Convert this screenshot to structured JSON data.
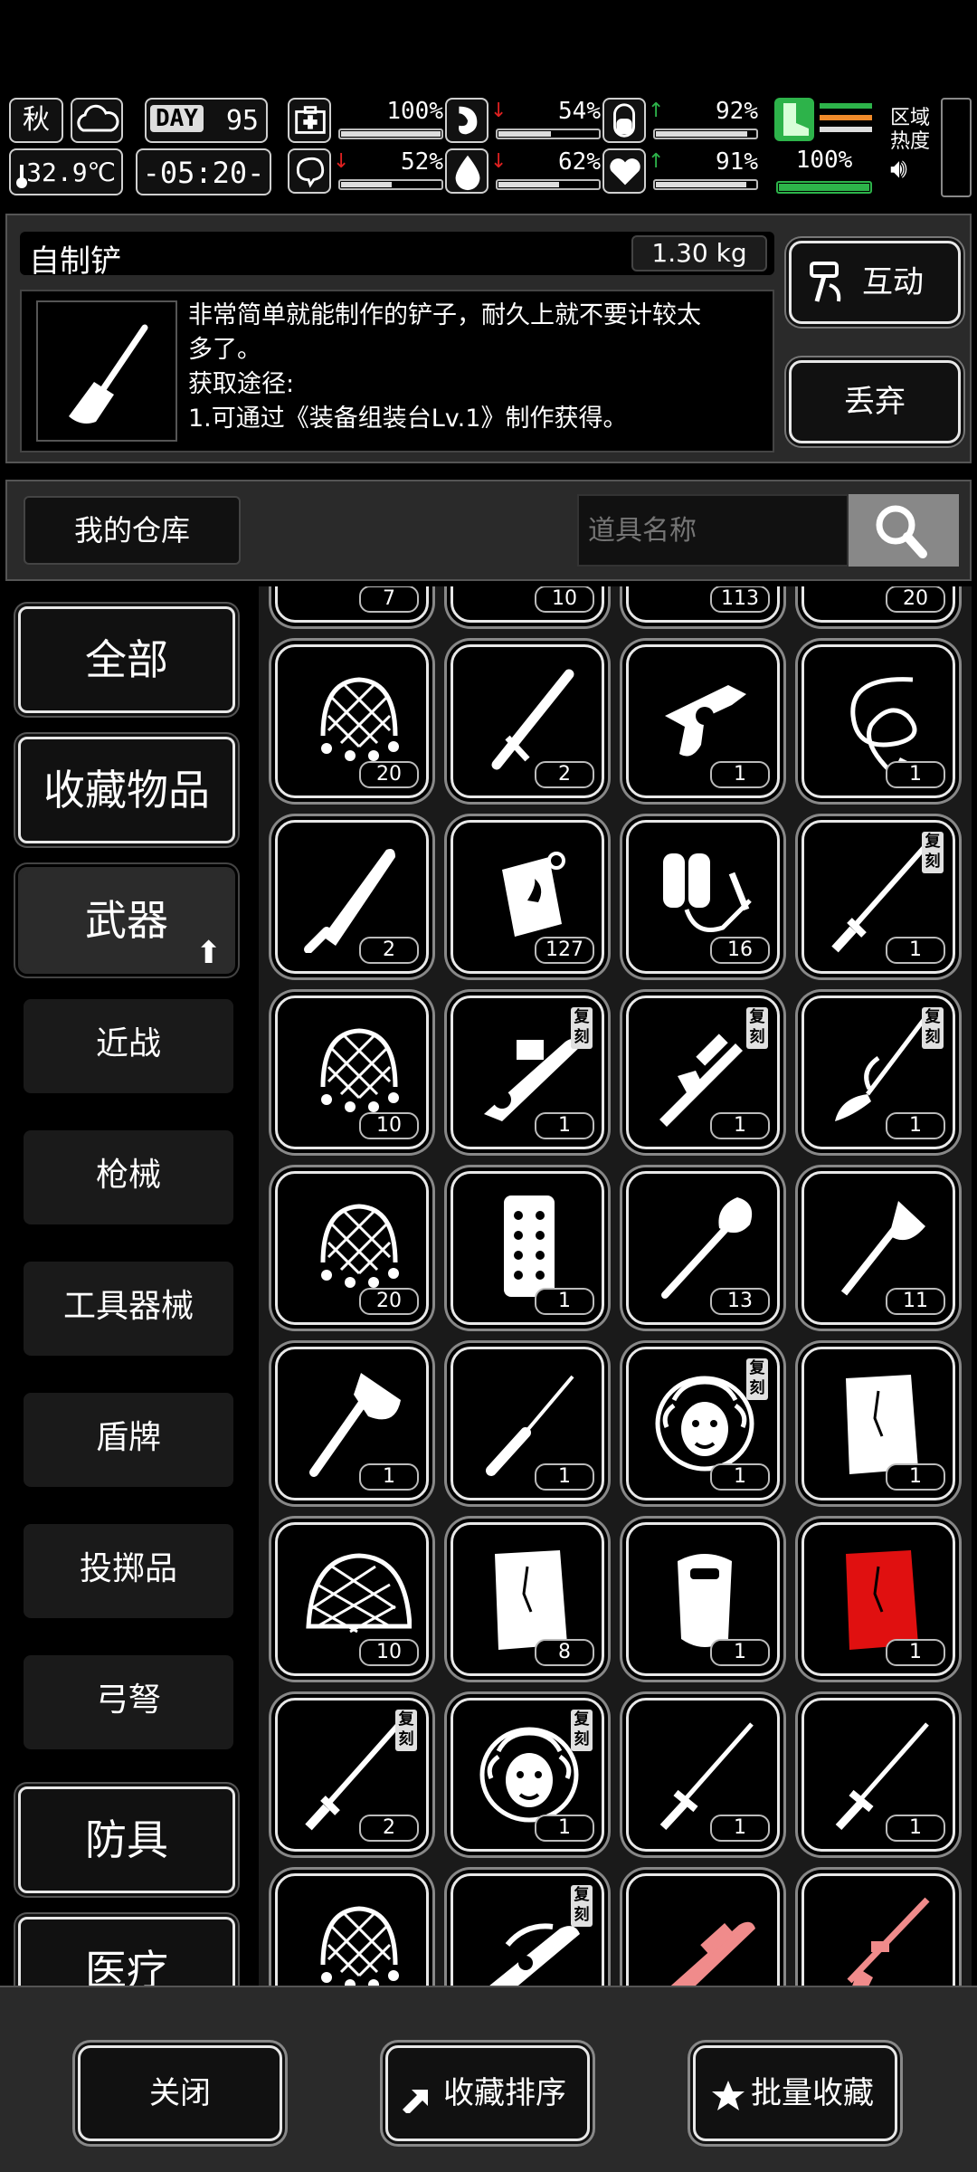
{
  "status": {
    "season": "秋",
    "temperature": "32.9℃",
    "day_label": "DAY",
    "day": "95",
    "clock": "-05:20-",
    "stats": [
      {
        "icon": "medkit-icon",
        "arrow": "",
        "value": "100%",
        "level": 1.0
      },
      {
        "icon": "stomach-icon",
        "arrow": "↓",
        "arrow_color": "#e02020",
        "value": "54%",
        "level": 0.54
      },
      {
        "icon": "pill-icon",
        "arrow": "↑",
        "arrow_color": "#2db34a",
        "value": "92%",
        "level": 0.92
      },
      {
        "icon": "brain-icon",
        "arrow": "↓",
        "arrow_color": "#e02020",
        "value": "52%",
        "level": 0.52
      },
      {
        "icon": "water-drop-icon",
        "arrow": "↓",
        "arrow_color": "#e02020",
        "value": "62%",
        "level": 0.62
      },
      {
        "icon": "heart-icon",
        "arrow": "↑",
        "arrow_color": "#2db34a",
        "value": "91%",
        "level": 0.91
      }
    ],
    "stamina": {
      "value": "100%",
      "level": 1.0
    },
    "region_line1": "区域",
    "region_line2": "热度"
  },
  "detail": {
    "name": "自制铲",
    "weight": "1.30 kg",
    "description_line1": "非常简单就能制作的铲子，耐久上就不要计较太",
    "description_line2": "多了。",
    "description_line3": "获取途径:",
    "description_line4": "1.可通过《装备组装台Lv.1》制作获得。",
    "interact_label": "互动",
    "drop_label": "丢弃"
  },
  "warehouse": {
    "title": "我的仓库",
    "search_placeholder": "道具名称"
  },
  "categories": {
    "all": "全部",
    "favorites": "收藏物品",
    "weapons": "武器",
    "sub": [
      "近战",
      "枪械",
      "工具器械",
      "盾牌",
      "投掷品",
      "弓弩"
    ],
    "armor": "防具",
    "medical": "医疗"
  },
  "grid": {
    "copy_tag": "复刻",
    "top_partial_counts": [
      "7",
      "10",
      "113",
      "20"
    ],
    "rows": [
      [
        {
          "icon": "net-icon",
          "count": "20"
        },
        {
          "icon": "baton-icon",
          "count": "2"
        },
        {
          "icon": "revolver-icon",
          "count": "1"
        },
        {
          "icon": "whip-icon",
          "count": "1"
        }
      ],
      [
        {
          "icon": "machete-icon",
          "count": "2"
        },
        {
          "icon": "fuel-canister-icon",
          "count": "127"
        },
        {
          "icon": "flamethrower-icon",
          "count": "16"
        },
        {
          "icon": "katana-icon",
          "count": "1",
          "copy": true
        }
      ],
      [
        {
          "icon": "net-icon",
          "count": "10"
        },
        {
          "icon": "rocket-launcher-icon",
          "count": "1",
          "copy": true
        },
        {
          "icon": "sniper-rifle-icon",
          "count": "1",
          "copy": true
        },
        {
          "icon": "glaive-icon",
          "count": "1",
          "copy": true
        }
      ],
      [
        {
          "icon": "net-icon",
          "count": "20"
        },
        {
          "icon": "plank-shield-icon",
          "count": "1"
        },
        {
          "icon": "shovel-icon",
          "count": "13"
        },
        {
          "icon": "hatchet-icon",
          "count": "11"
        }
      ],
      [
        {
          "icon": "axe-icon",
          "count": "1"
        },
        {
          "icon": "knife-icon",
          "count": "1"
        },
        {
          "icon": "medusa-shield-icon",
          "count": "1",
          "copy": true
        },
        {
          "icon": "wooden-board-icon",
          "count": "1"
        }
      ],
      [
        {
          "icon": "turtle-net-icon",
          "count": "10"
        },
        {
          "icon": "wooden-board-icon",
          "count": "8"
        },
        {
          "icon": "riot-shield-icon",
          "count": "1"
        },
        {
          "icon": "red-board-icon",
          "count": "1"
        }
      ],
      [
        {
          "icon": "katana-icon",
          "count": "2",
          "copy": true
        },
        {
          "icon": "medusa-shield-icon",
          "count": "1",
          "copy": true
        },
        {
          "icon": "sword-icon",
          "count": "1"
        },
        {
          "icon": "sword-icon",
          "count": "1"
        }
      ],
      [
        {
          "icon": "net-icon",
          "count": ""
        },
        {
          "icon": "dragon-gun-icon",
          "count": "",
          "copy": true
        },
        {
          "icon": "pink-shotgun-icon",
          "count": ""
        },
        {
          "icon": "pink-rifle-icon",
          "count": ""
        }
      ]
    ]
  },
  "bottom": {
    "close": "关闭",
    "sort": "收藏排序",
    "batch": "批量收藏"
  },
  "colors": {
    "accent_green": "#2db34a",
    "down_red": "#e02020",
    "panel": "#2a2a2a",
    "pink_weapon": "#f08b8b",
    "red_board": "#e01010"
  }
}
